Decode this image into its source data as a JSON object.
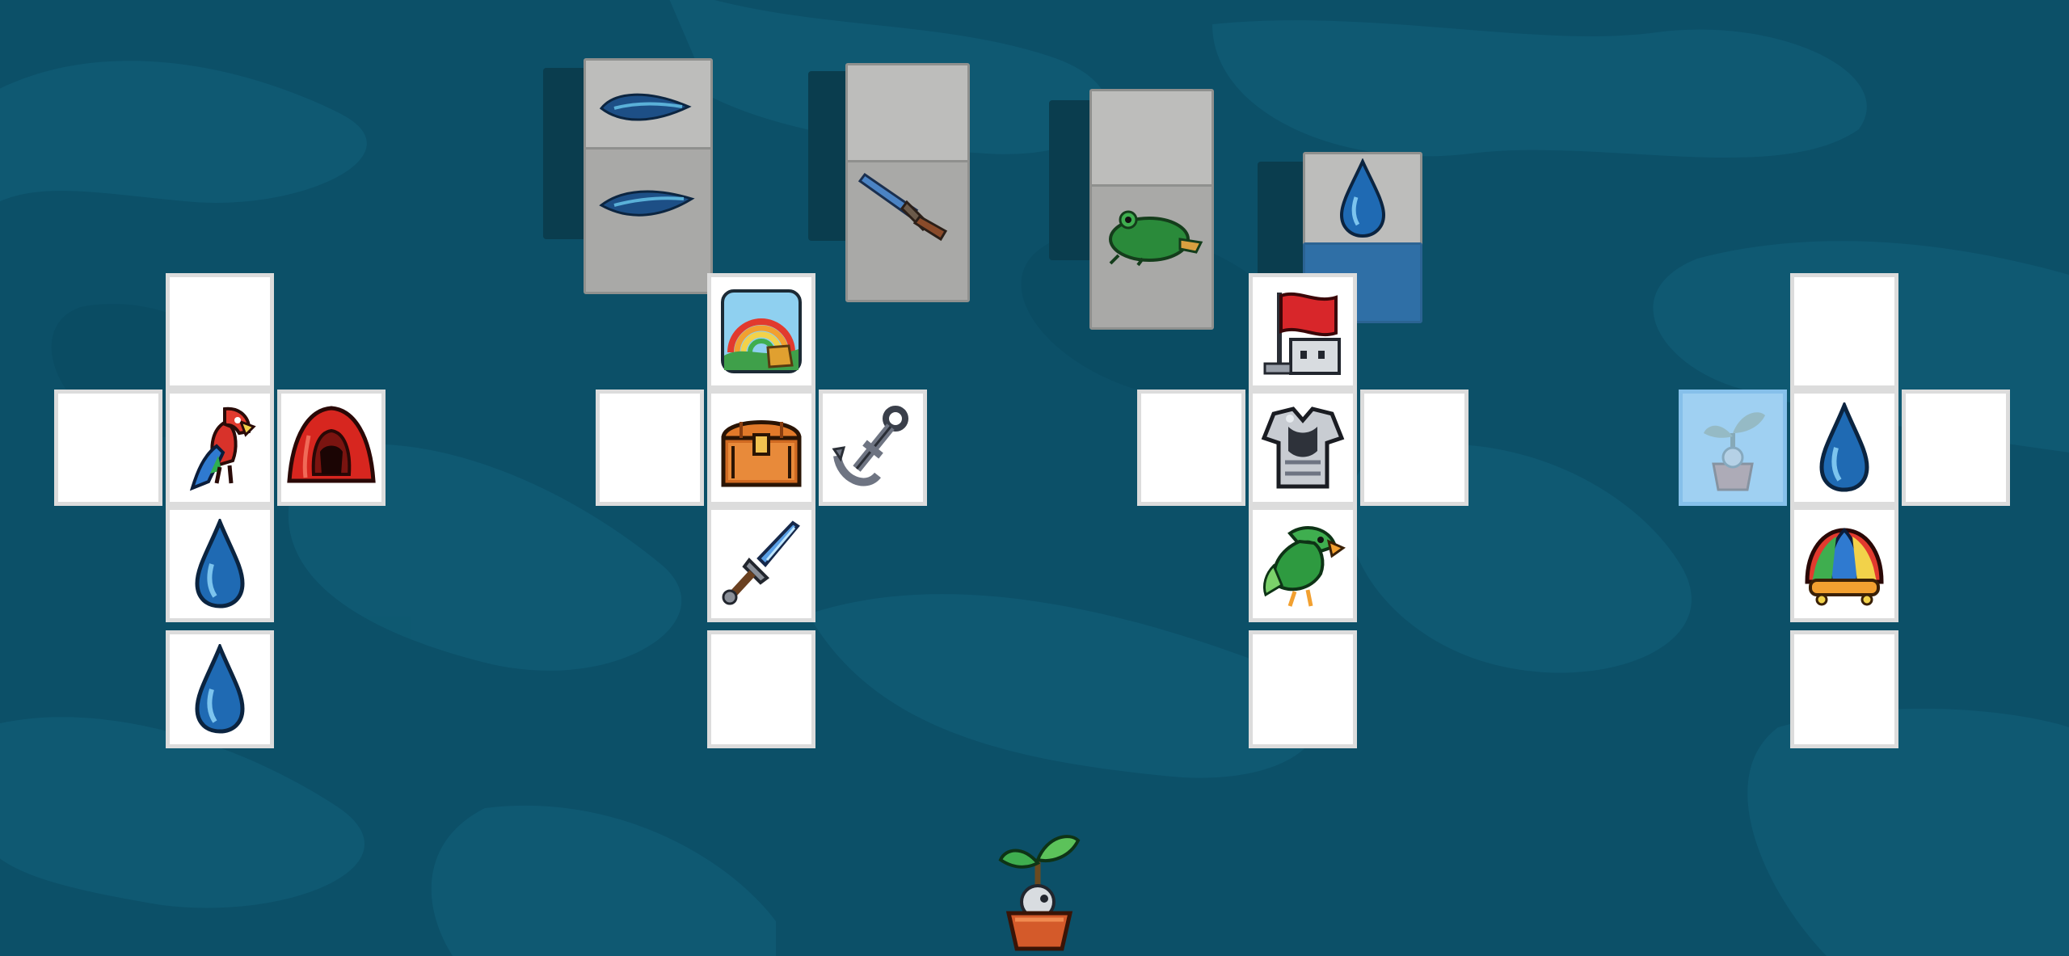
{
  "game": {
    "title": "",
    "background": "#0c5068",
    "rolled_dice": [
      {
        "id": "die-1",
        "faces": [
          "feather-icon",
          "feather-icon"
        ]
      },
      {
        "id": "die-2",
        "faces": [
          "blank",
          "sword-icon"
        ]
      },
      {
        "id": "die-3",
        "faces": [
          "blank",
          "frog-icon"
        ]
      },
      {
        "id": "die-4",
        "faces": [
          "water-drop-icon",
          "blue-face"
        ]
      }
    ],
    "dice_nets": [
      {
        "name": "net-1",
        "faces": {
          "top": "empty",
          "left": "empty",
          "center": "parrot-icon",
          "right": "red-hood-icon",
          "below": "water-drop-icon",
          "bottom": "water-drop-icon"
        }
      },
      {
        "name": "net-2",
        "faces": {
          "top": "rainbow-icon",
          "left": "empty",
          "center": "treasure-chest-icon",
          "right": "anchor-icon",
          "below": "sword-icon",
          "bottom": "empty"
        }
      },
      {
        "name": "net-3",
        "faces": {
          "top": "red-flag-icon",
          "left": "empty",
          "center": "armor-icon",
          "right": "empty",
          "below": "green-parrot-icon",
          "bottom": "empty"
        }
      },
      {
        "name": "net-4",
        "faces": {
          "top": "empty",
          "left": "sprout-pot-icon-ghost",
          "center": "water-drop-icon",
          "right": "empty",
          "below": "jester-hat-icon",
          "bottom": "empty"
        }
      }
    ],
    "player": {
      "icon": "sprout-pot-icon"
    }
  }
}
